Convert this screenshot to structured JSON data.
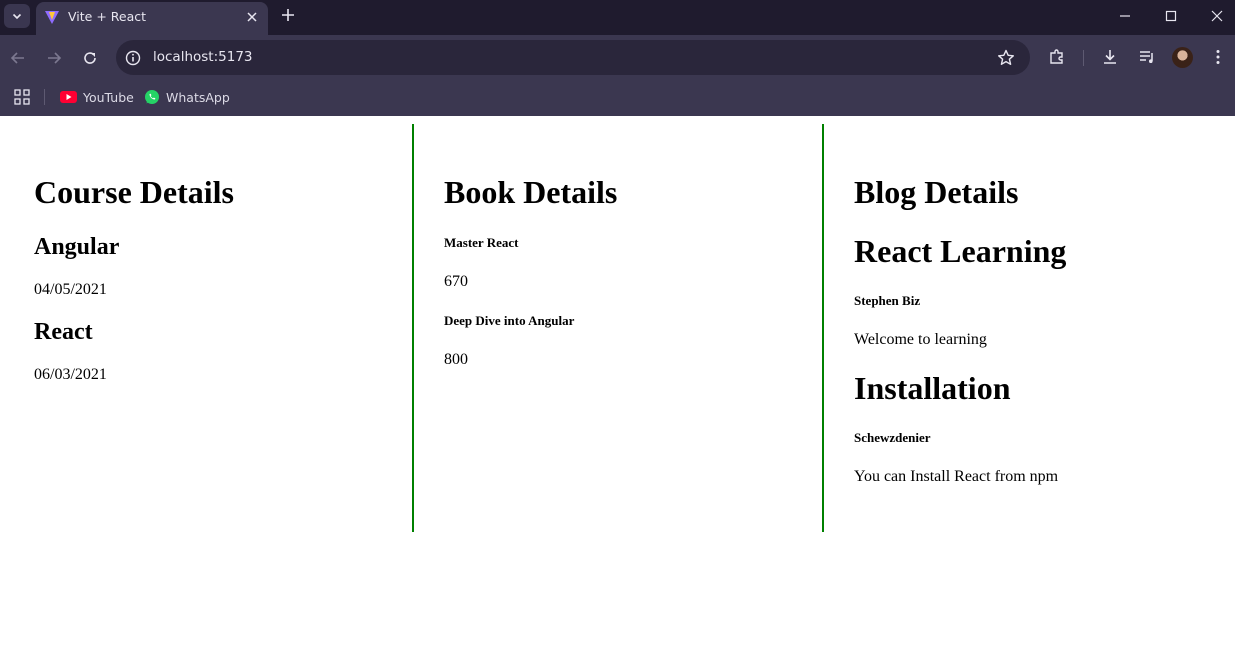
{
  "browser": {
    "tab": {
      "title": "Vite + React"
    },
    "address": {
      "url": "localhost:5173"
    },
    "bookmarks": [
      {
        "label": "YouTube",
        "icon": "youtube-icon"
      },
      {
        "label": "WhatsApp",
        "icon": "whatsapp-icon"
      }
    ]
  },
  "page": {
    "course": {
      "heading": "Course Details",
      "items": [
        {
          "name": "Angular",
          "date": "04/05/2021"
        },
        {
          "name": "React",
          "date": "06/03/2021"
        }
      ]
    },
    "book": {
      "heading": "Book Details",
      "items": [
        {
          "title": "Master React",
          "price": "670"
        },
        {
          "title": "Deep Dive into Angular",
          "price": "800"
        }
      ]
    },
    "blog": {
      "heading": "Blog Details",
      "items": [
        {
          "title": "React Learning",
          "author": "Stephen Biz",
          "content": "Welcome to learning"
        },
        {
          "title": "Installation",
          "author": "Schewzdenier",
          "content": "You can Install React from npm"
        }
      ]
    }
  },
  "colors": {
    "column_border": "#008000",
    "titlebar": "#1f1b2e",
    "toolbar": "#3b3750"
  }
}
